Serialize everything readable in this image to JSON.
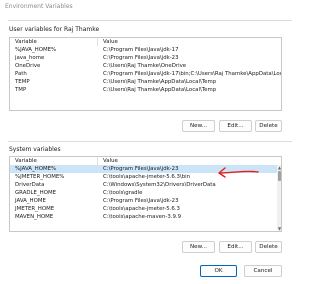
{
  "window": {
    "title": "Environment Variables"
  },
  "user_section": {
    "label": "User variables for Raj Thamke",
    "headers": {
      "variable": "Variable",
      "value": "Value"
    },
    "rows": [
      {
        "variable": "%JAVA_HOME%",
        "value": "C:\\Program Files\\Java\\jdk-17"
      },
      {
        "variable": "java_home",
        "value": "C:\\Program Files\\Java\\jdk-23"
      },
      {
        "variable": "OneDrive",
        "value": "C:\\Users\\Raj Thamke\\OneDrive"
      },
      {
        "variable": "Path",
        "value": "C:\\Program Files\\Java\\jdk-17\\bin;C:\\Users\\Raj Thamke\\AppData\\Local\\"
      },
      {
        "variable": "TEMP",
        "value": "C:\\Users\\Raj Thamke\\AppData\\Local\\Temp"
      },
      {
        "variable": "TMP",
        "value": "C:\\Users\\Raj Thamke\\AppData\\Local\\Temp"
      }
    ],
    "buttons": {
      "new": "New...",
      "edit": "Edit...",
      "delete": "Delete"
    }
  },
  "system_section": {
    "label": "System variables",
    "headers": {
      "variable": "Variable",
      "value": "Value"
    },
    "rows": [
      {
        "variable": "%JAVA_HOME%",
        "value": "C:\\Program Files\\Java\\jdk-23"
      },
      {
        "variable": "%JMETER_HOME%",
        "value": "C:\\tools\\apache-jmeter-5.6.3\\bin"
      },
      {
        "variable": "DriverData",
        "value": "C:\\Windows\\System32\\Drivers\\DriverData"
      },
      {
        "variable": "GRADLE_HOME",
        "value": "C:\\tools\\gradle"
      },
      {
        "variable": "JAVA_HOME",
        "value": "C:\\Program Files\\Java\\jdk-23"
      },
      {
        "variable": "JMETER_HOME",
        "value": "C:\\tools\\apache-jmeter-5.6.3"
      },
      {
        "variable": "MAVEN_HOME",
        "value": "C:\\tools\\apache-maven-3.9.9"
      }
    ],
    "buttons": {
      "new": "New...",
      "edit": "Edit...",
      "delete": "Delete"
    }
  },
  "footer": {
    "ok": "OK",
    "cancel": "Cancel"
  },
  "colors": {
    "selection": "#cce4f7",
    "accent": "#0067c0",
    "annotation": "#e02020"
  }
}
